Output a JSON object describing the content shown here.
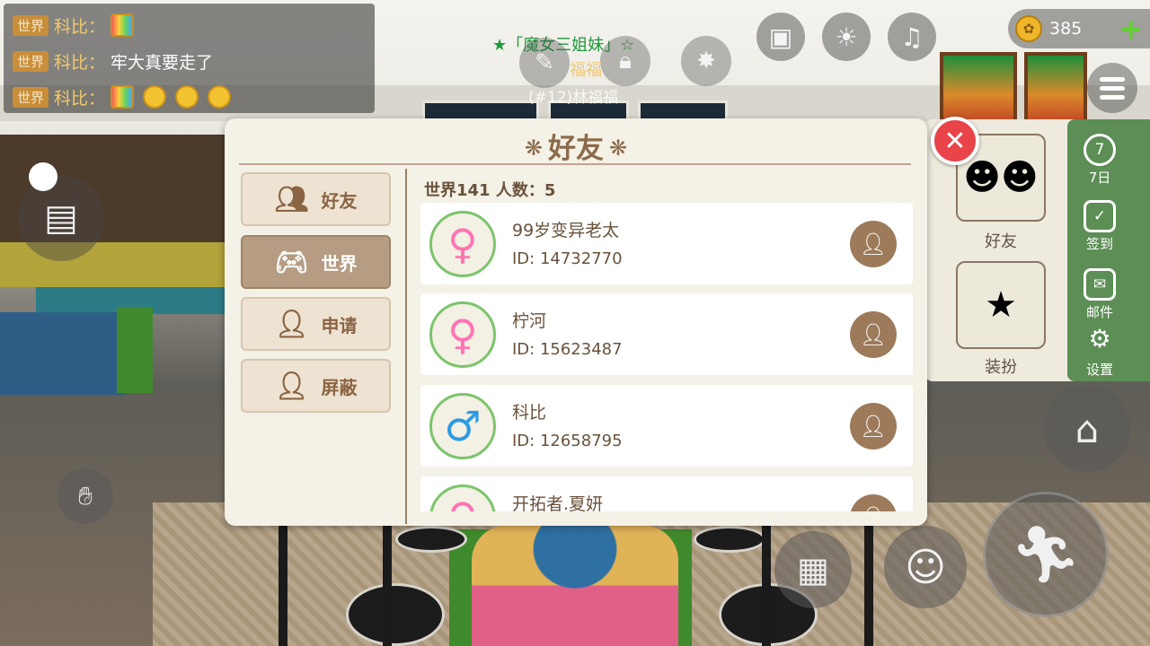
{
  "chat": [
    {
      "tag": "世界",
      "name": "科比：",
      "message": "",
      "emojis": [
        "flag"
      ]
    },
    {
      "tag": "世界",
      "name": "科比：",
      "message": "牢大真要走了",
      "emojis": []
    },
    {
      "tag": "世界",
      "name": "科比：",
      "message": "",
      "emojis": [
        "flag",
        "laugh",
        "laugh",
        "laugh"
      ]
    }
  ],
  "hud": {
    "coins": "385",
    "coin_icon": "coin-icon",
    "team_title": "★「魔女三姐妹」☆",
    "player_name": "福福",
    "player_tag": "(#12)林福福"
  },
  "dialog": {
    "title": "好友",
    "world_info": "世界141  人数：5",
    "nav": [
      {
        "label": "好友",
        "icon": "friends-icon",
        "active": false
      },
      {
        "label": "世界",
        "icon": "gamepad-icon",
        "active": true
      },
      {
        "label": "申请",
        "icon": "add-request-icon",
        "active": false
      },
      {
        "label": "屏蔽",
        "icon": "block-icon",
        "active": false
      }
    ],
    "friends": [
      {
        "name": "99岁变异老太",
        "id": "ID: 14732770",
        "gender": "female"
      },
      {
        "name": "柠河",
        "id": "ID: 15623487",
        "gender": "female"
      },
      {
        "name": "科比",
        "id": "ID: 12658795",
        "gender": "male"
      },
      {
        "name": "开拓者.夏妍",
        "id": "",
        "gender": "female"
      }
    ]
  },
  "right_panel": {
    "tiles": [
      {
        "label": "好友"
      },
      {
        "label": "装扮"
      }
    ],
    "side": [
      {
        "label": "7日",
        "icon": "calendar-7-icon"
      },
      {
        "label": "签到",
        "icon": "checkin-icon"
      },
      {
        "label": "邮件",
        "icon": "mail-icon"
      },
      {
        "label": "设置",
        "icon": "gear-icon"
      }
    ]
  },
  "colors": {
    "dialog_bg": "#f4f1e6",
    "accent_brown": "#8b6a4a",
    "active_tab": "#b59c83",
    "close_red": "#e8444a",
    "female_pink": "#ff74b4",
    "male_blue": "#2c9be4",
    "coin_plus": "#5fd12e"
  }
}
